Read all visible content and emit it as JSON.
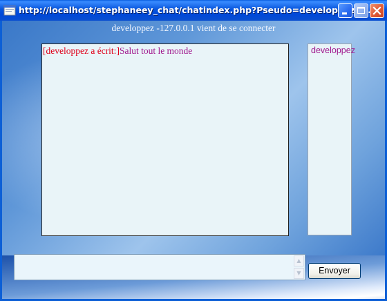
{
  "window": {
    "title": "http://localhost/stephaneey_chat/chatindex.php?Pseudo=developpez - ...",
    "accent_color": "#0855dd"
  },
  "status": {
    "text": "developpez -127.0.0.1 vient de se connecter"
  },
  "chat": {
    "messages": [
      {
        "prefix": "[developpez a écrit:]",
        "text": "Salut tout le monde"
      }
    ],
    "prefix_color": "#e0001a",
    "text_color": "#a0168c"
  },
  "users": {
    "list": [
      "developpez"
    ]
  },
  "composer": {
    "input_value": "",
    "send_label": "Envoyer"
  }
}
